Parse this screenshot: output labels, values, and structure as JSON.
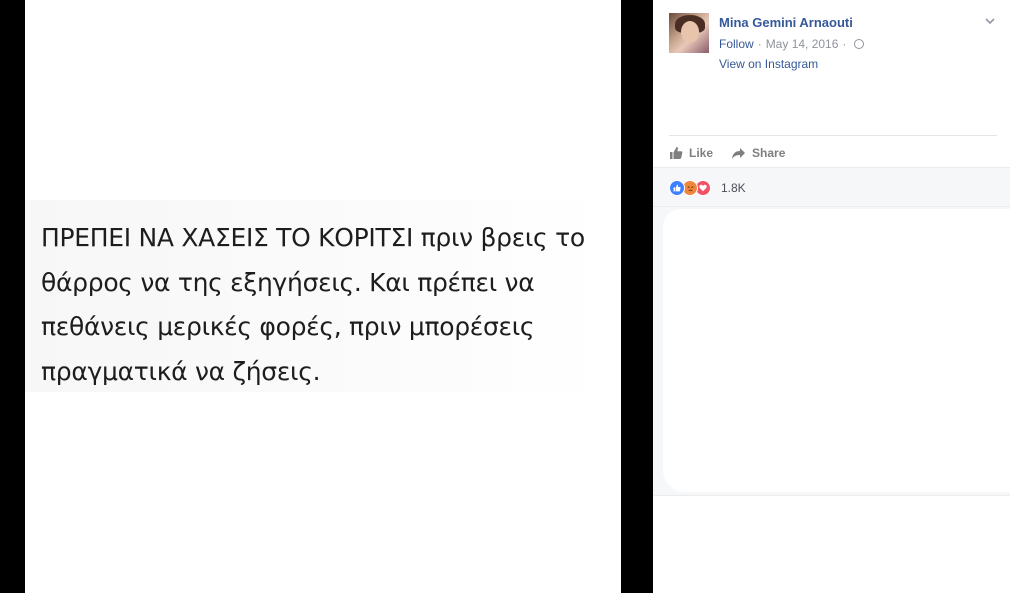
{
  "photo": {
    "quote": "ΠΡΕΠΕΙ ΝΑ ΧΑΣΕΙΣ ΤΟ ΚΟΡΙΤΣΙ πριν βρεις το\nθάρρος να της εξηγήσεις. Και πρέπει να\nπεθάνεις μερικές φορές, πριν μπορέσεις\nπραγματικά να ζήσεις."
  },
  "post": {
    "author": "Mina Gemini Arnaouti",
    "follow_label": "Follow",
    "date": "May 14, 2016",
    "separator": "·",
    "privacy_icon": "globe-icon",
    "view_on_instagram": "View on Instagram"
  },
  "actions": {
    "like_label": "Like",
    "share_label": "Share"
  },
  "reactions": {
    "icons": [
      "like-reaction-icon",
      "angry-reaction-icon",
      "love-reaction-icon"
    ],
    "count": "1.8K"
  },
  "colors": {
    "link": "#365899",
    "muted": "#90949c",
    "like": "#4080ff",
    "angry": "#f0863c",
    "love": "#f25268"
  }
}
